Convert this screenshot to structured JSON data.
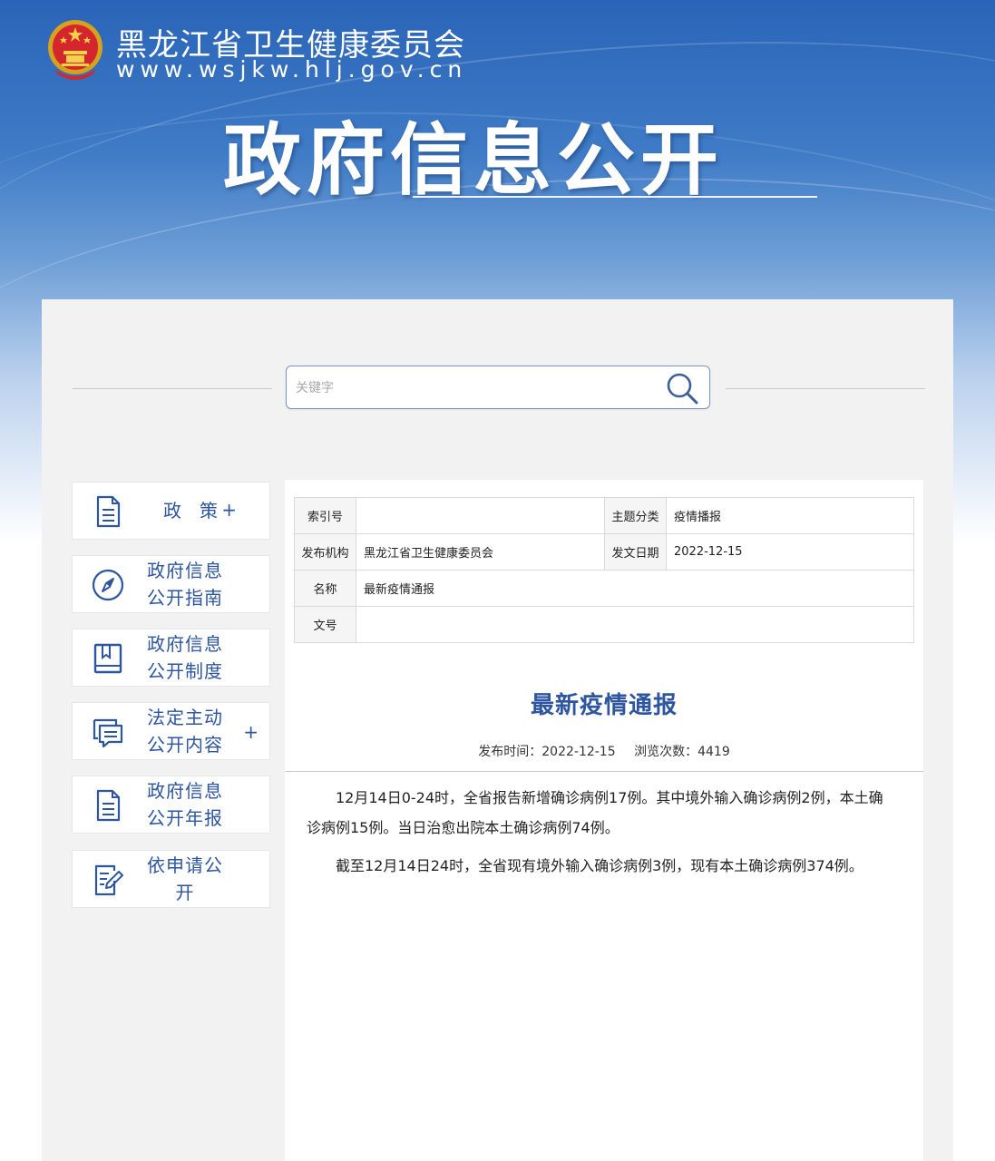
{
  "header": {
    "site_name": "黑龙江省卫生健康委员会",
    "site_url": "www.wsjkw.hlj.gov.cn",
    "banner_title": "政府信息公开"
  },
  "search": {
    "placeholder": "关键字"
  },
  "sidebar": {
    "items": [
      {
        "label": "政策",
        "icon": "document-icon",
        "has_plus": true,
        "plus": "+"
      },
      {
        "label": "政府信息公开指南",
        "icon": "compass-icon",
        "has_plus": false
      },
      {
        "label": "政府信息公开制度",
        "icon": "book-icon",
        "has_plus": false
      },
      {
        "label": "法定主动公开内容",
        "icon": "chat-icon",
        "has_plus": true,
        "plus": "+"
      },
      {
        "label": "政府信息公开年报",
        "icon": "report-icon",
        "has_plus": false
      },
      {
        "label": "依申请公开",
        "icon": "edit-doc-icon",
        "has_plus": false
      }
    ]
  },
  "meta": {
    "index_no_label": "索引号",
    "index_no_value": "",
    "topic_label": "主题分类",
    "topic_value": "疫情播报",
    "publisher_label": "发布机构",
    "publisher_value": "黑龙江省卫生健康委员会",
    "date_label": "发文日期",
    "date_value": "2022-12-15",
    "name_label": "名称",
    "name_value": "最新疫情通报",
    "doc_no_label": "文号",
    "doc_no_value": ""
  },
  "article": {
    "title": "最新疫情通报",
    "publish_time": "发布时间：2022-12-15",
    "views": "浏览次数：4419",
    "paragraphs": [
      "12月14日0-24时，全省报告新增确诊病例17例。其中境外输入确诊病例2例，本土确诊病例15例。当日治愈出院本土确诊病例74例。",
      "截至12月14日24时，全省现有境外输入确诊病例3例，现有本土确诊病例374例。"
    ]
  },
  "colors": {
    "accent": "#2d55a0",
    "header_blue": "#2a64b8"
  }
}
